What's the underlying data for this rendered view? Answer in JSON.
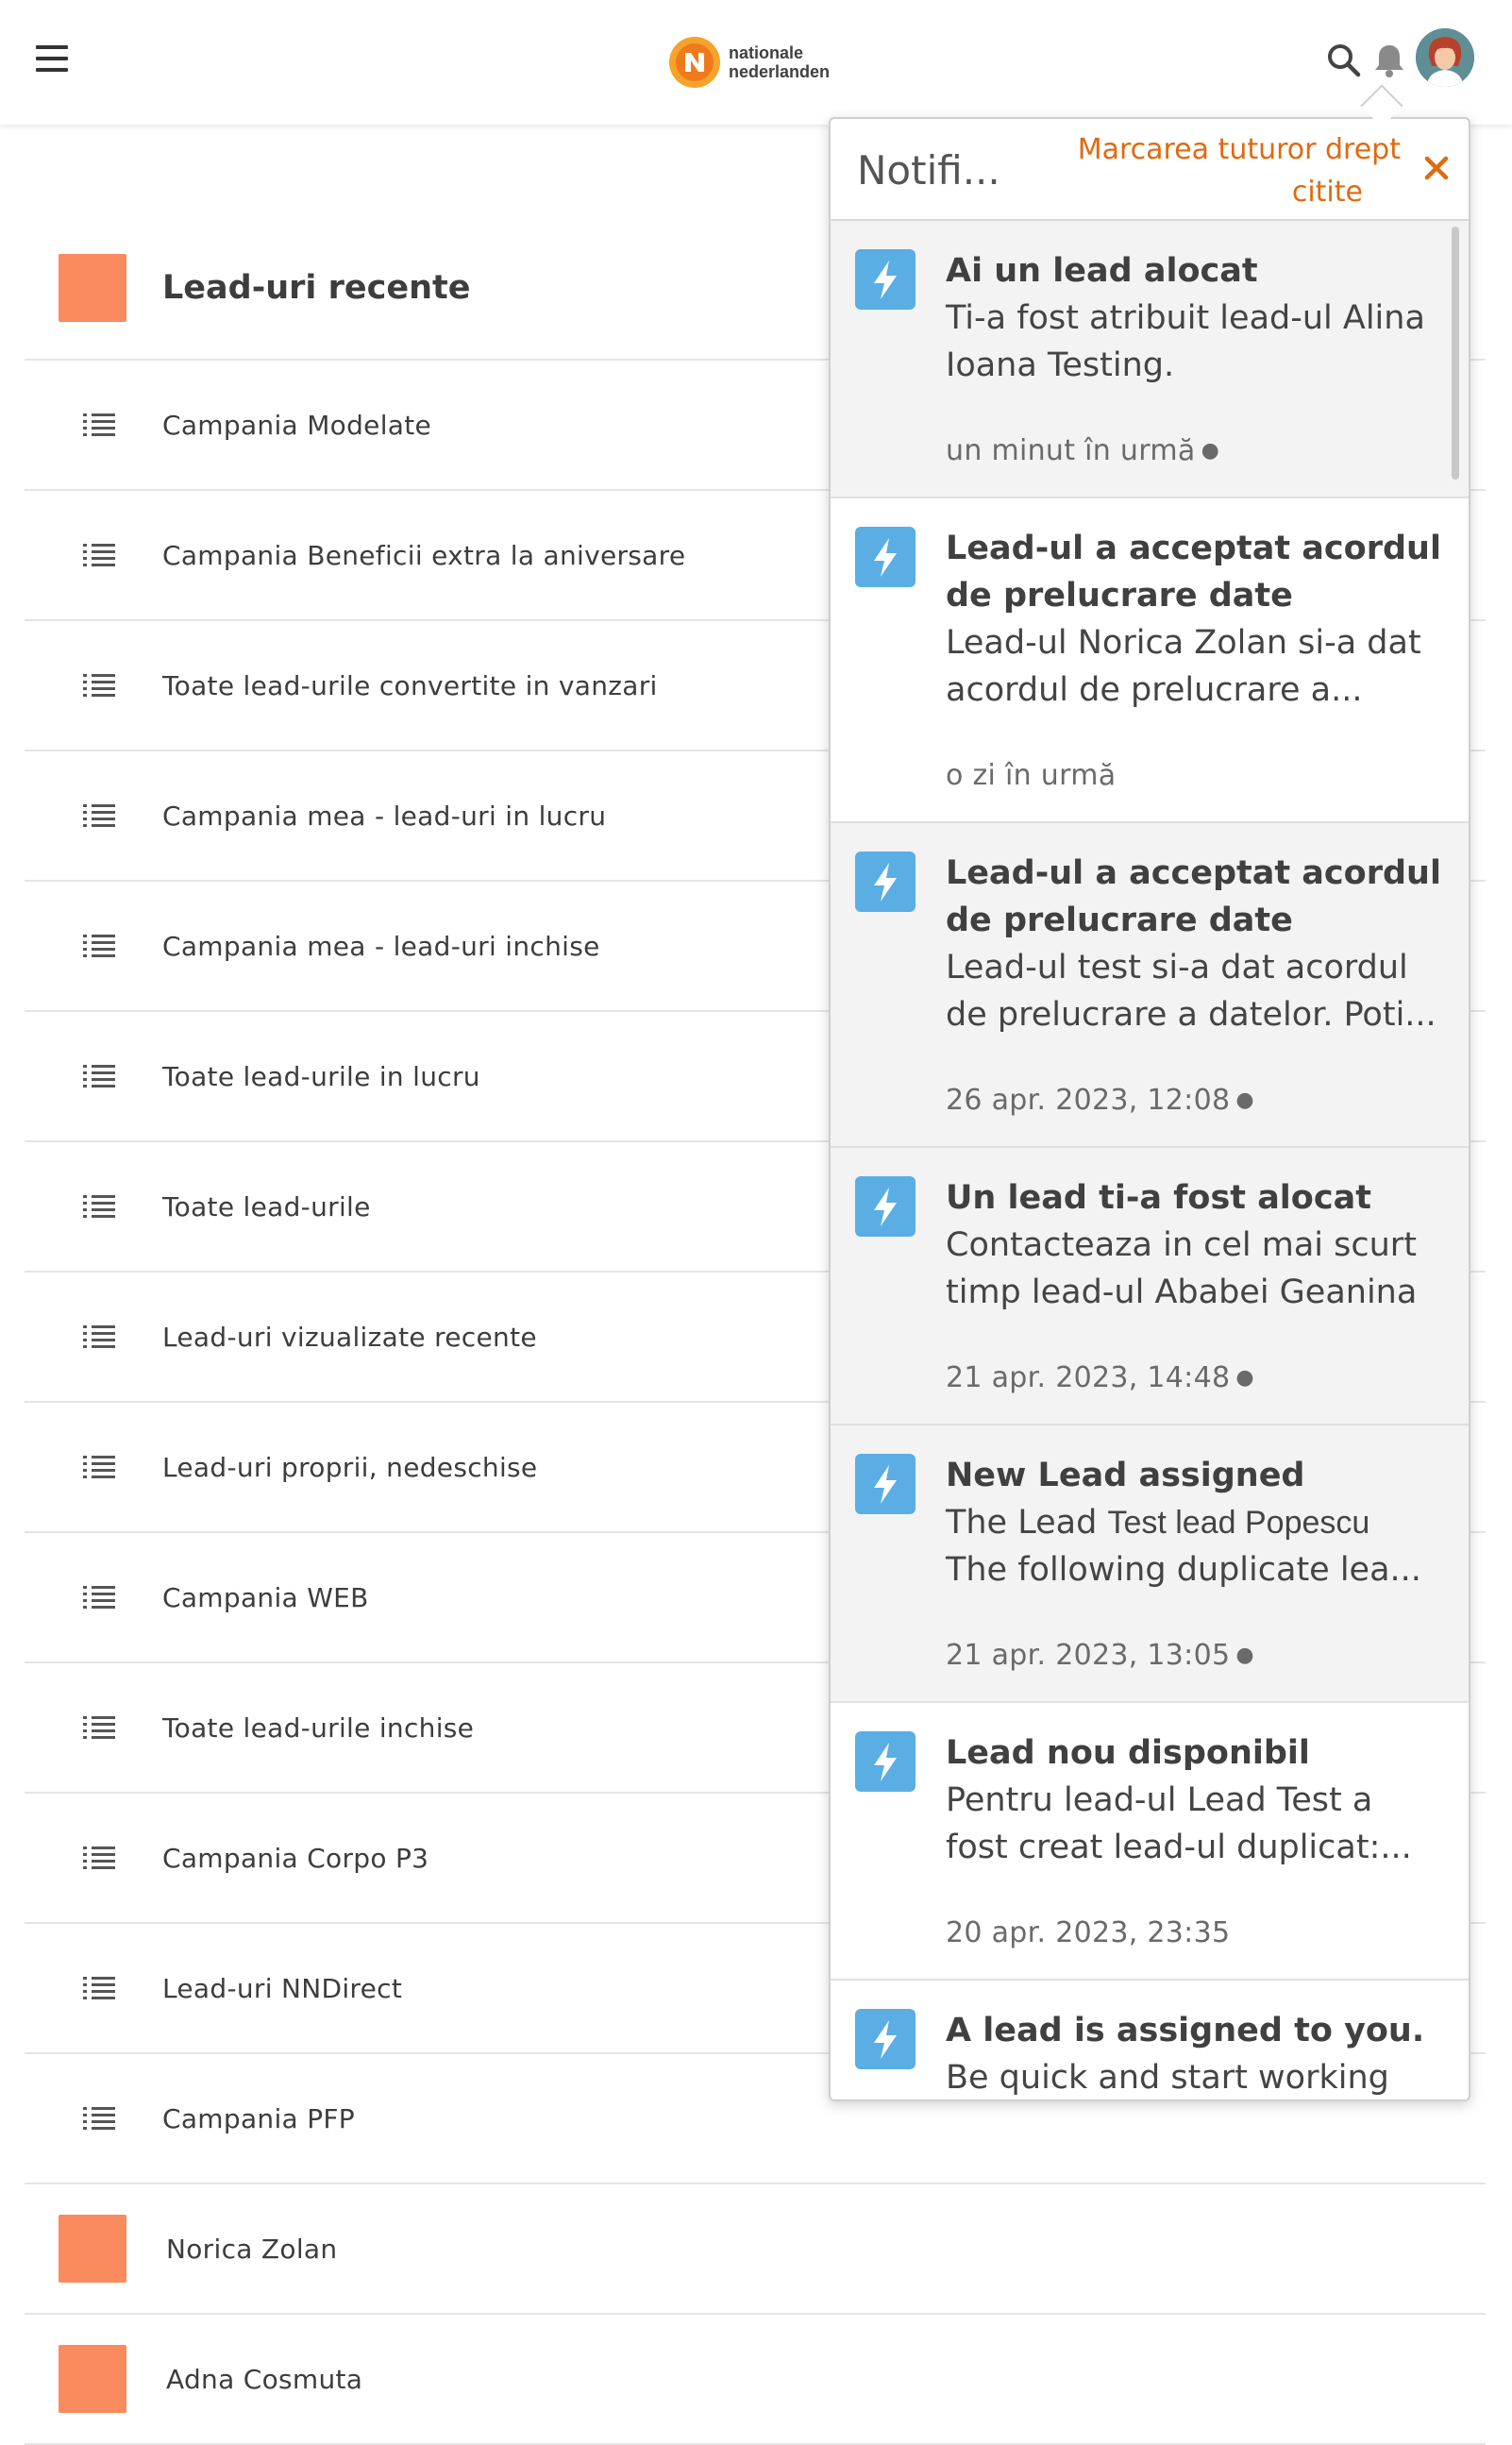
{
  "header": {
    "logo_line1": "nationale",
    "logo_line2": "nederlanden"
  },
  "list": {
    "title": "Lead-uri recente",
    "items": [
      "Campania Modelate",
      "Campania Beneficii extra la aniversare",
      "Toate lead-urile convertite in vanzari",
      "Campania mea - lead-uri in lucru",
      "Campania mea - lead-uri inchise",
      "Toate lead-urile in lucru",
      "Toate lead-urile",
      "Lead-uri vizualizate recente",
      "Lead-uri proprii, nedeschise",
      "Campania WEB",
      "Toate lead-urile inchise",
      "Campania Corpo P3",
      "Lead-uri NNDirect",
      "Campania PFP"
    ],
    "people": [
      "Norica Zolan",
      "Adna Cosmuta"
    ]
  },
  "notifications": {
    "title": "Notifi...",
    "mark_all_line1": "Marcarea tuturor drept",
    "mark_all_line2": "citite",
    "items": [
      {
        "title_line1": "Ai un lead alocat",
        "body_line1": "Ti-a fost atribuit lead-ul Alina",
        "body_line2": "Ioana Testing.",
        "time": "un minut în urmă",
        "unread_dot": "●"
      },
      {
        "title_line1": "Lead-ul a acceptat acordul",
        "title_line2": "de prelucrare date",
        "body_line1": "Lead-ul Norica Zolan si-a dat",
        "body_line2": "acordul de prelucrare a...",
        "time": "o zi în urmă"
      },
      {
        "title_line1": "Lead-ul a acceptat acordul",
        "title_line2": "de prelucrare date",
        "body_line1": "Lead-ul test si-a dat acordul",
        "body_line2": "de prelucrare a datelor. Poti...",
        "time": "26 apr. 2023, 12:08",
        "unread_dot": "●"
      },
      {
        "title_line1": "Un lead ti-a fost alocat",
        "body_line1": "Contacteaza in cel mai scurt",
        "body_line2": "timp lead-ul Ababei Geanina",
        "time": "21 apr. 2023, 14:48",
        "unread_dot": "●"
      },
      {
        "title_line1": "New Lead assigned",
        "body_line1a": "The Lead",
        "body_line1b": "Test lead Popescu",
        "body_line2": "The following duplicate lea...",
        "time": "21 apr. 2023, 13:05",
        "unread_dot": "●"
      },
      {
        "title_line1": "Lead nou disponibil",
        "body_line1": "Pentru lead-ul Lead Test a",
        "body_line2": "fost creat lead-ul duplicat:...",
        "time": "20 apr. 2023, 23:35"
      },
      {
        "title_line1": "A lead is assigned to you.",
        "body_line1": "Be quick and start working"
      }
    ]
  }
}
